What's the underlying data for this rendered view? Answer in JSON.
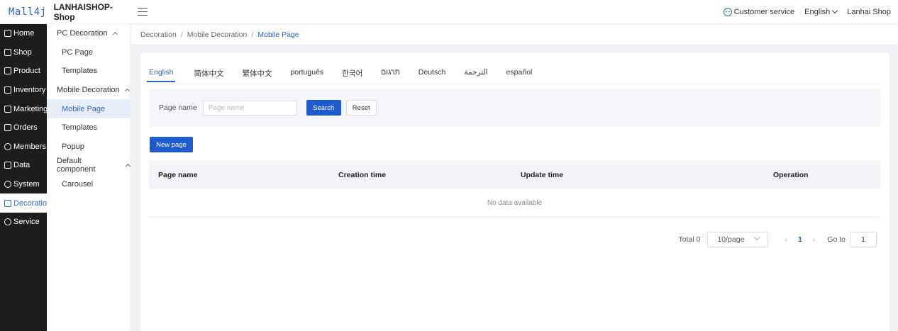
{
  "header": {
    "brand": "Mall4j",
    "shop_name": "LANHAISHOP-Shop",
    "customer_service": "Customer service",
    "language": "English",
    "user": "Lanhai Shop"
  },
  "sidebar_primary": {
    "items": [
      {
        "label": "Home",
        "icon": "home-icon"
      },
      {
        "label": "Shop",
        "icon": "shop-icon"
      },
      {
        "label": "Product",
        "icon": "product-icon"
      },
      {
        "label": "Inventory",
        "icon": "inventory-icon"
      },
      {
        "label": "Marketing",
        "icon": "gift-icon"
      },
      {
        "label": "Orders",
        "icon": "orders-icon"
      },
      {
        "label": "Members",
        "icon": "members-icon"
      },
      {
        "label": "Data",
        "icon": "data-icon"
      },
      {
        "label": "System",
        "icon": "gear-icon"
      },
      {
        "label": "Decoration",
        "icon": "decoration-icon"
      },
      {
        "label": "Service",
        "icon": "chat-icon"
      }
    ],
    "active": "Decoration"
  },
  "sidebar_secondary": {
    "groups": [
      {
        "label": "PC Decoration",
        "items": [
          "PC Page",
          "Templates"
        ]
      },
      {
        "label": "Mobile Decoration",
        "items": [
          "Mobile Page",
          "Templates",
          "Popup"
        ]
      },
      {
        "label": "Default component",
        "items": [
          "Carousel"
        ]
      }
    ],
    "active": "Mobile Page"
  },
  "breadcrumb": [
    "Decoration",
    "Mobile Decoration",
    "Mobile Page"
  ],
  "tabs": [
    "English",
    "简体中文",
    "繁体中文",
    "português",
    "한국어",
    "תרגום",
    "Deutsch",
    "الترجمة",
    "español"
  ],
  "active_tab": "English",
  "search": {
    "label": "Page name",
    "placeholder": "Page name",
    "value": "",
    "search_button": "Search",
    "reset_button": "Reset"
  },
  "new_page_button": "New page",
  "table": {
    "columns": [
      "Page name",
      "Creation time",
      "Update time",
      "Operation"
    ],
    "rows": [],
    "empty_text": "No data available"
  },
  "pagination": {
    "total": "Total 0",
    "page_size": "10/page",
    "current_page": "1",
    "goto_label": "Go to",
    "goto_value": "1"
  },
  "colors": {
    "accent": "#1f5bd0",
    "sidebar_bg": "#1d1d1d"
  }
}
